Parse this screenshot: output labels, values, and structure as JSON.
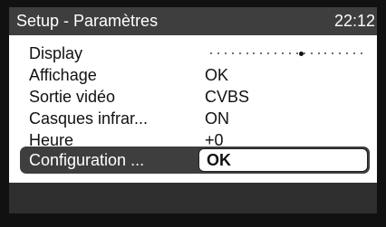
{
  "header": {
    "title": "Setup - Paramètres",
    "time": "22:12"
  },
  "menu": {
    "items": [
      {
        "label": "Display",
        "display_level": 0.6
      },
      {
        "label": "Affichage",
        "value": "OK"
      },
      {
        "label": "Sortie vidéo",
        "value": "CVBS"
      },
      {
        "label": "Casques infrar...",
        "value": "ON"
      },
      {
        "label": "Heure",
        "value": "+0"
      }
    ],
    "selected": {
      "label": "Configuration ...",
      "value": "OK"
    }
  },
  "colors": {
    "title_bar": "#3e3e3e",
    "screen_background": "#ffffff",
    "text": "#111111"
  }
}
